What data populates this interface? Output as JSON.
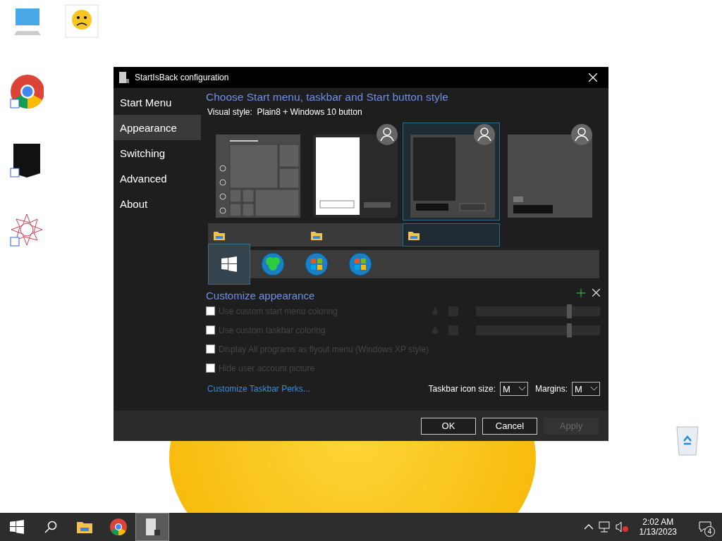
{
  "window": {
    "title": "StartIsBack configuration"
  },
  "sidebar": {
    "items": [
      {
        "label": "Start Menu",
        "selected": false
      },
      {
        "label": "Appearance",
        "selected": true
      },
      {
        "label": "Switching",
        "selected": false
      },
      {
        "label": "Advanced",
        "selected": false
      },
      {
        "label": "About",
        "selected": false
      }
    ]
  },
  "heading": "Choose Start menu, taskbar and Start button style",
  "visual_style": {
    "label": "Visual style:",
    "value": "Plain8 + Windows 10 button"
  },
  "menu_styles": [
    {
      "kind": "tiles",
      "selected": false
    },
    {
      "kind": "classic",
      "selected": false
    },
    {
      "kind": "dark",
      "selected": true
    },
    {
      "kind": "plain",
      "selected": false
    }
  ],
  "taskbar_styles": [
    {
      "selected": false
    },
    {
      "selected": false
    },
    {
      "selected": true
    }
  ],
  "start_buttons": [
    {
      "kind": "windows10",
      "selected": true
    },
    {
      "kind": "clover",
      "selected": false
    },
    {
      "kind": "windows7",
      "selected": false
    },
    {
      "kind": "windows8",
      "selected": false
    }
  ],
  "customize": {
    "heading": "Customize appearance",
    "options": [
      {
        "label": "Use custom start menu coloring",
        "checked": false,
        "disabled": true
      },
      {
        "label": "Use custom taskbar coloring",
        "checked": false,
        "disabled": true
      },
      {
        "label": "Display All programs as flyout menu (Windows XP style)",
        "checked": false,
        "disabled": true
      },
      {
        "label": "Hide user account picture",
        "checked": false,
        "disabled": true
      }
    ],
    "sliders": [
      {
        "level": 0.75
      },
      {
        "level": 0.75
      }
    ],
    "link": "Customize Taskbar Perks...",
    "icon_size": {
      "label": "Taskbar icon size:",
      "value": "M"
    },
    "margins": {
      "label": "Margins:",
      "value": "M"
    }
  },
  "buttons": [
    {
      "label": "OK",
      "disabled": false
    },
    {
      "label": "Cancel",
      "disabled": false
    },
    {
      "label": "Apply",
      "disabled": true
    }
  ],
  "taskbar": {
    "time": "2:02 AM",
    "date": "1/13/2023",
    "notifications": "4"
  }
}
